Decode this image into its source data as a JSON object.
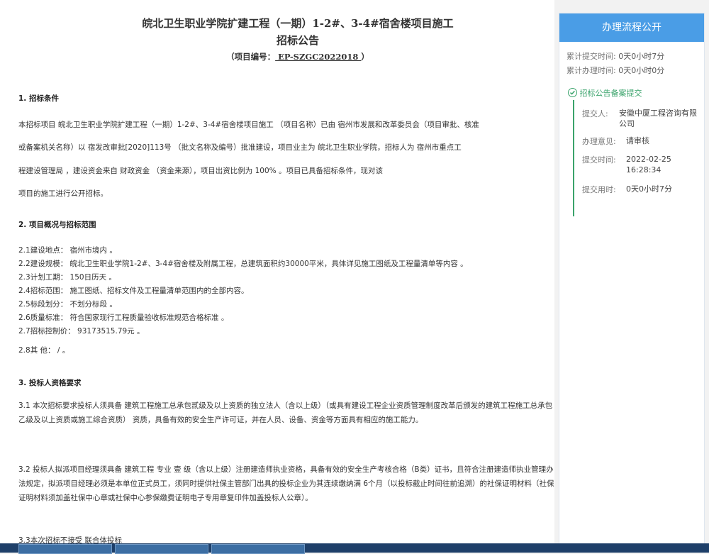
{
  "doc": {
    "title_line1": "皖北卫生职业学院扩建工程（一期）1-2#、3-4#宿舍楼项目施工",
    "title_line2": "招标公告",
    "project_no_label": "（项目编号：",
    "project_no": "  EP-SZGC2022018   ",
    "project_no_end": "）",
    "s1_head": "1. 招标条件",
    "s1_p1": "本招标项目 皖北卫生职业学院扩建工程（一期）1-2#、3-4#宿舍楼项目施工 （项目名称）已由 宿州市发展和改革委员会（项目审批、核准",
    "s1_p2": "或备案机关名称）以 宿发改审批[2020]113号   （批文名称及编号）批准建设，项目业主为 皖北卫生职业学院，招标人为 宿州市重点工",
    "s1_p3": "程建设管理局    ，建设资金来自   财政资金      （资金来源），项目出资比例为      100%        。项目已具备招标条件，现对该",
    "s1_p4": "项目的施工进行公开招标。",
    "s2_head": "2. 项目概况与招标范围",
    "s2_items": [
      "2.1建设地点： 宿州市境内      。",
      "2.2建设规模： 皖北卫生职业学院1-2#、3-4#宿舍楼及附属工程，总建筑面积约30000平米，具体详见施工图纸及工程量清单等内容 。",
      "2.3计划工期：   150日历天        。",
      "2.4招标范围： 施工图纸、招标文件及工程量清单范围内的全部内容。",
      "2.5标段划分： 不划分标段        。",
      "2.6质量标准： 符合国家现行工程质量验收标准规范合格标准     。",
      "2.7招标控制价：        93173515.79元        。",
      "2.8其    他：            /      。"
    ],
    "s3_head": "3. 投标人资格要求",
    "s3_p1": "3.1 本次招标要求投标人须具备 建筑工程施工总承包贰级及以上资质的独立法人（含以上级）（或具有建设工程企业资质管理制度改革后颁发的建筑工程施工总承包乙级及以上资质或施工综合资质）  资质，具备有效的安全生产许可证，并在人员、设备、资金等方面具有相应的施工能力。",
    "s3_p2": "3.2 投标人拟派项目经理须具备 建筑工程  专业  壹   级（含以上级）注册建造师执业资格，具备有效的安全生产考核合格（B类）证书，且符合注册建造师执业管理办法规定，拟派项目经理必须是本单位正式员工，须同时提供社保主管部门出具的投标企业为其连续缴纳满 6个月（以投标截止时间往前追溯）的社保证明材料（社保证明材料须加盖社保中心章或社保中心参保缴费证明电子专用章复印件加盖投标人公章）。",
    "s3_p3_cut": "3.3本次招标不接受 联合体投标"
  },
  "panel": {
    "header": "办理流程公开",
    "cum_submit_label": "累计提交时间:",
    "cum_submit_value": "0天0小时7分",
    "cum_handle_label": "累计办理时间:",
    "cum_handle_value": "0天0小时0分",
    "step_icon": "check-circle-icon",
    "step_title": "招标公告备案提交",
    "submitter_label": "提交人:",
    "submitter_value": "安徽中厦工程咨询有限公司",
    "opinion_label": "办理意见:",
    "opinion_value": "请审核",
    "submit_time_label": "提交时间:",
    "submit_time_value": "2022-02-25 16:28:34",
    "submit_use_label": "提交用时:",
    "submit_use_value": "0天0小时7分"
  },
  "colors": {
    "accent": "#4a9de6",
    "step_green": "#3aa36b",
    "taskbar": "#1e3f69"
  }
}
